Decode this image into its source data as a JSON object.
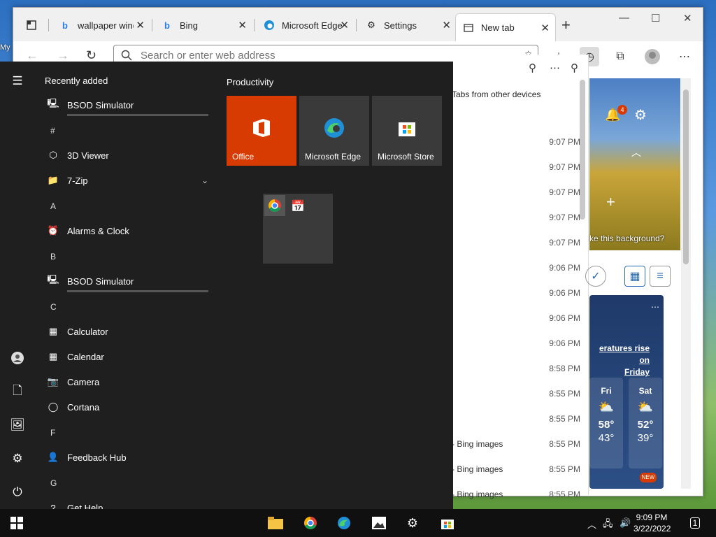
{
  "desktop": {
    "label": "My"
  },
  "browser": {
    "tabs": [
      {
        "label": "wallpaper wind",
        "icon": "bing-icon"
      },
      {
        "label": "Bing",
        "icon": "bing-icon"
      },
      {
        "label": "Microsoft Edge",
        "icon": "edge-icon"
      },
      {
        "label": "Settings",
        "icon": "gear-icon"
      },
      {
        "label": "New tab",
        "icon": "newtab-icon"
      }
    ],
    "address_placeholder": "Search or enter web address"
  },
  "history": {
    "tabs_from_devices": "Tabs from other devices",
    "rows": [
      {
        "name": "",
        "time": "9:07 PM"
      },
      {
        "name": "",
        "time": "9:07 PM"
      },
      {
        "name": "",
        "time": "9:07 PM"
      },
      {
        "name": "",
        "time": "9:07 PM"
      },
      {
        "name": "",
        "time": "9:07 PM"
      },
      {
        "name": "",
        "time": "9:06 PM"
      },
      {
        "name": "",
        "time": "9:06 PM"
      },
      {
        "name": "",
        "time": "9:06 PM"
      },
      {
        "name": "",
        "time": "9:06 PM"
      },
      {
        "name": "",
        "time": "8:58 PM"
      },
      {
        "name": "",
        "time": "8:55 PM"
      },
      {
        "name": "",
        "time": "8:55 PM"
      },
      {
        "name": "xp - Bing images",
        "time": "8:55 PM"
      },
      {
        "name": "xp - Bing images",
        "time": "8:55 PM"
      },
      {
        "name": "xp - Bing images",
        "time": "8:55 PM"
      }
    ]
  },
  "ntp": {
    "notif_count": "4",
    "bg_question": "ke this background?",
    "weather_text_1": "eratures rise on",
    "weather_text_2": "Friday",
    "days": [
      {
        "d": "Fri",
        "h": "58°",
        "l": "43°"
      },
      {
        "d": "Sat",
        "h": "52°",
        "l": "39°"
      }
    ],
    "new_badge": "NEW"
  },
  "start": {
    "recently_added": "Recently added",
    "productivity": "Productivity",
    "apps": [
      {
        "type": "app",
        "label": "BSOD Simulator",
        "icon": "monitor-icon",
        "bar": true
      },
      {
        "type": "letter",
        "label": "#"
      },
      {
        "type": "app",
        "label": "3D Viewer",
        "icon": "cube-icon"
      },
      {
        "type": "app",
        "label": "7-Zip",
        "icon": "folder-icon",
        "chev": true
      },
      {
        "type": "letter",
        "label": "A"
      },
      {
        "type": "app",
        "label": "Alarms & Clock",
        "icon": "clock-icon"
      },
      {
        "type": "letter",
        "label": "B"
      },
      {
        "type": "app",
        "label": "BSOD Simulator",
        "icon": "monitor-icon",
        "bar": true
      },
      {
        "type": "letter",
        "label": "C"
      },
      {
        "type": "app",
        "label": "Calculator",
        "icon": "calculator-icon"
      },
      {
        "type": "app",
        "label": "Calendar",
        "icon": "calendar-icon"
      },
      {
        "type": "app",
        "label": "Camera",
        "icon": "camera-icon"
      },
      {
        "type": "app",
        "label": "Cortana",
        "icon": "cortana-icon"
      },
      {
        "type": "letter",
        "label": "F"
      },
      {
        "type": "app",
        "label": "Feedback Hub",
        "icon": "feedback-icon"
      },
      {
        "type": "letter",
        "label": "G"
      },
      {
        "type": "app",
        "label": "Get Help",
        "icon": "help-icon"
      }
    ],
    "tiles": [
      {
        "label": "Office",
        "color": "#d83b01"
      },
      {
        "label": "Microsoft Edge",
        "color": "#3a3a3a"
      },
      {
        "label": "Microsoft Store",
        "color": "#3a3a3a"
      }
    ]
  },
  "taskbar": {
    "time": "9:09 PM",
    "date": "3/22/2022",
    "notif": "1"
  }
}
